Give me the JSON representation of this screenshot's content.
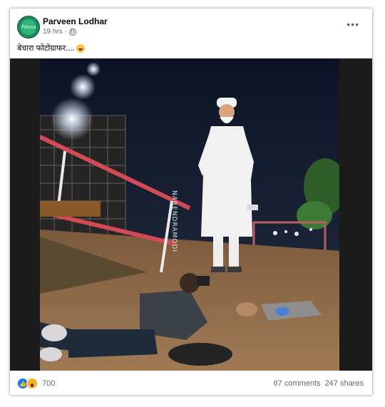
{
  "post": {
    "author": "Parveen Lodhar",
    "timestamp": "19 hrs",
    "separator": "·",
    "privacy_icon": "globe-icon",
    "more_icon": "•••",
    "caption": "बेचारा फोटोग्राफर....",
    "caption_emoji": "grinning-sweat-emoji",
    "avatar_text": "Pdoms"
  },
  "reactions": {
    "icons": [
      "like-icon",
      "wow-icon"
    ],
    "count": "700",
    "comments": "67 comments",
    "shares": "247 shares"
  },
  "image": {
    "watermark": "NARENDRAMODI"
  },
  "colors": {
    "like_blue": "#1877f2",
    "wow_yellow": "#f7b125",
    "meta_gray": "#65676b"
  }
}
